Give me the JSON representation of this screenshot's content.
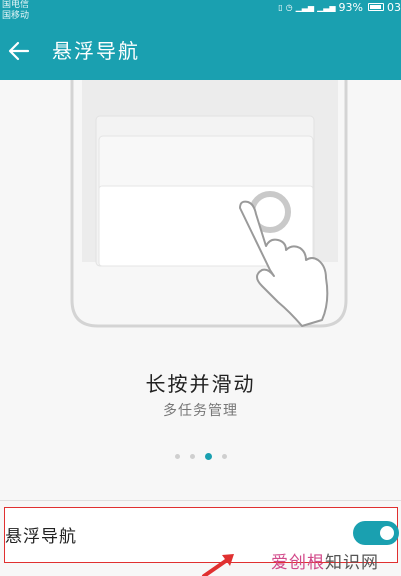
{
  "status_bar": {
    "carrier_line1": "国电信",
    "carrier_line2": "国移动",
    "battery": "93%",
    "time": "03"
  },
  "header": {
    "title": "悬浮导航"
  },
  "slide": {
    "title": "长按并滑动",
    "subtitle": "多任务管理",
    "page_index": 3,
    "page_count": 4
  },
  "setting": {
    "label": "悬浮导航",
    "enabled": true
  },
  "watermark": {
    "part1": "爱创根",
    "part2": "知识网"
  },
  "colors": {
    "accent": "#1aa0b0",
    "highlight_border": "#e03030",
    "watermark": "#d24a8a"
  },
  "icons": {
    "back": "arrow-left-icon",
    "gesture": "hand-press-icon"
  }
}
